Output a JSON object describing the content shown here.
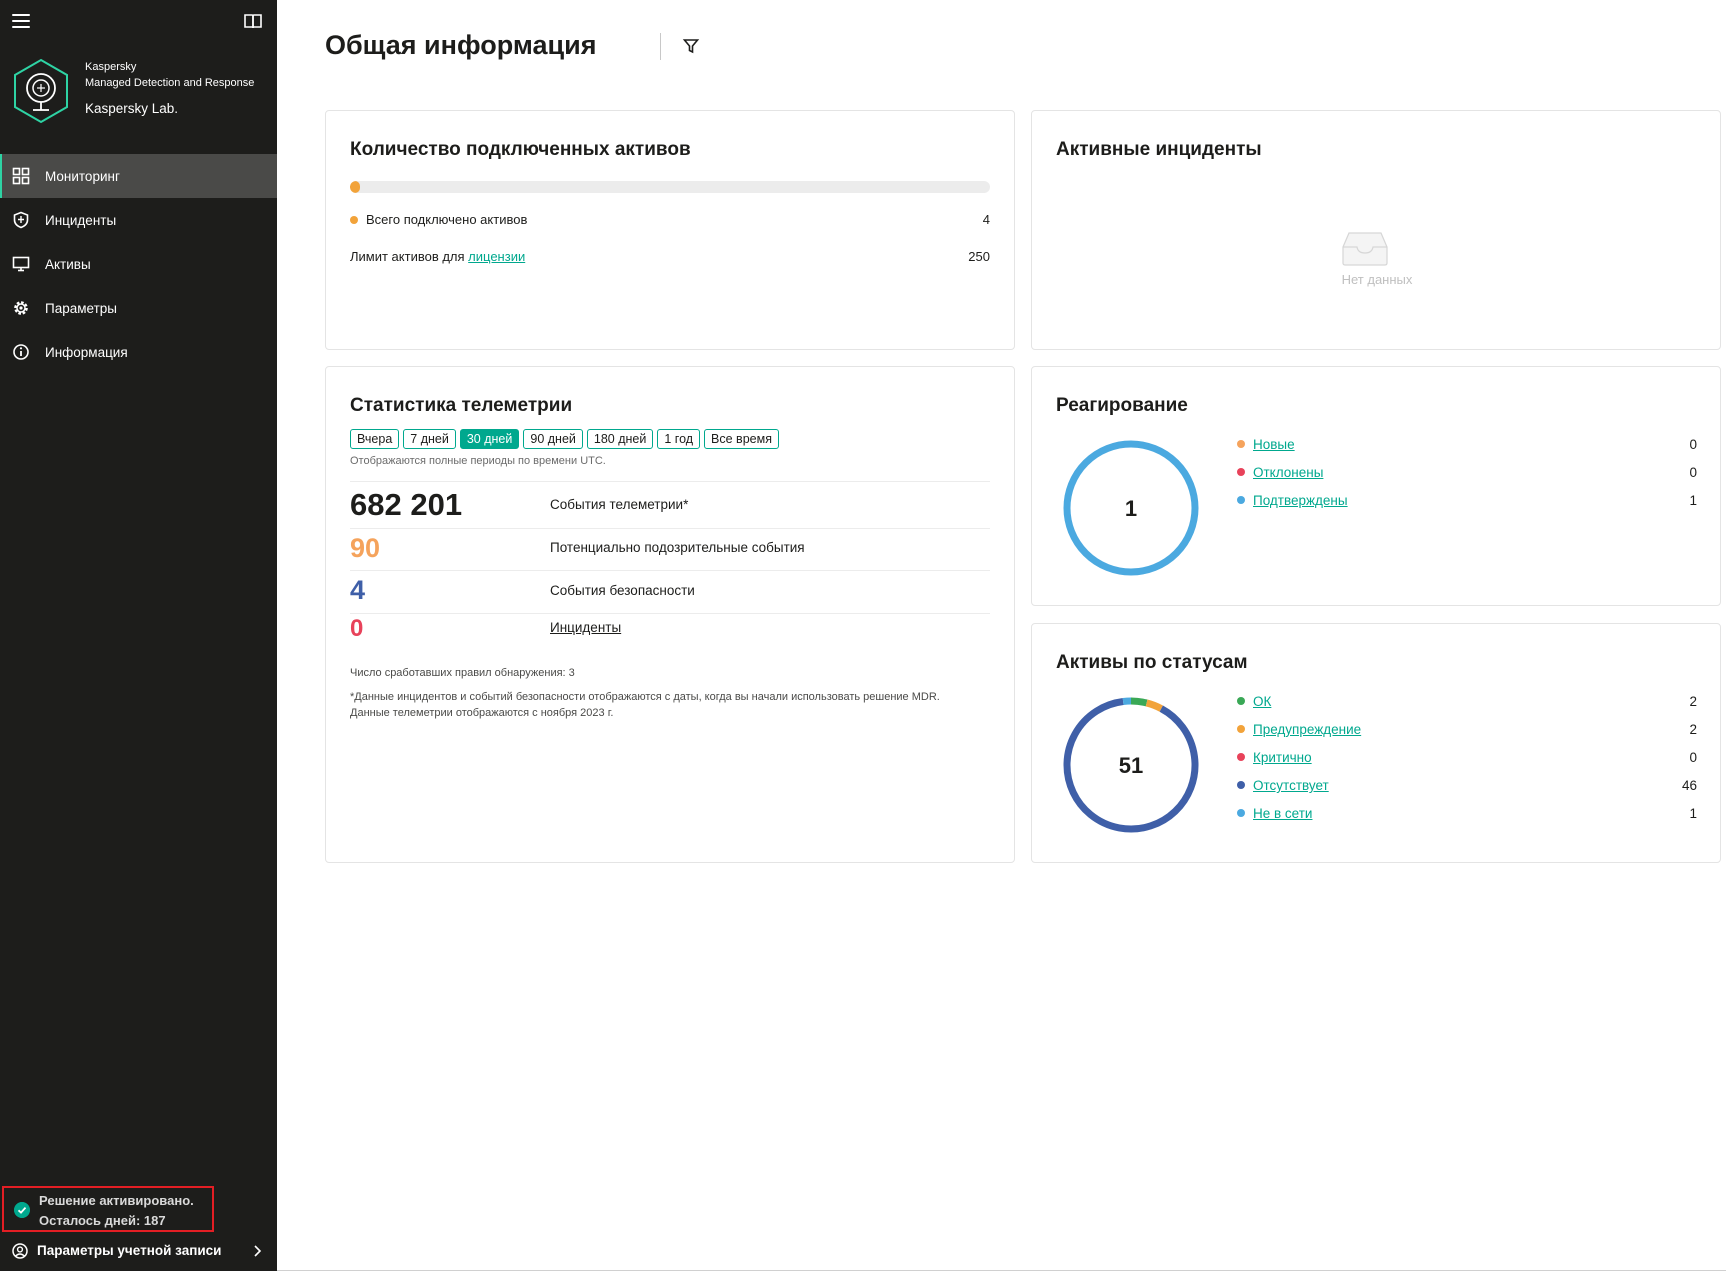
{
  "sidebar": {
    "brand": {
      "vendor": "Kaspersky",
      "product": "Managed Detection and Response",
      "organization": "Kaspersky Lab."
    },
    "nav": [
      {
        "label": "Мониторинг",
        "icon": "dashboard-icon",
        "active": true
      },
      {
        "label": "Инциденты",
        "icon": "shield-icon",
        "active": false
      },
      {
        "label": "Активы",
        "icon": "monitor-icon",
        "active": false
      },
      {
        "label": "Параметры",
        "icon": "gear-icon",
        "active": false
      },
      {
        "label": "Информация",
        "icon": "info-icon",
        "active": false
      }
    ],
    "activation": {
      "line1": "Решение активировано.",
      "line2": "Осталось дней: 187"
    },
    "account_label": "Параметры учетной записи"
  },
  "page": {
    "title": "Общая информация"
  },
  "assets_card": {
    "title": "Количество подключенных активов",
    "connected_label": "Всего подключено активов",
    "connected_value": "4",
    "limit_label_prefix": "Лимит активов для ",
    "limit_link": "лицензии",
    "limit_value": "250",
    "progress_fraction": 0.016
  },
  "incidents_card": {
    "title": "Активные инциденты",
    "empty_text": "Нет данных"
  },
  "telemetry_card": {
    "title": "Статистика телеметрии",
    "periods": [
      {
        "label": "Вчера",
        "active": false
      },
      {
        "label": "7 дней",
        "active": false
      },
      {
        "label": "30 дней",
        "active": true
      },
      {
        "label": "90 дней",
        "active": false
      },
      {
        "label": "180 дней",
        "active": false
      },
      {
        "label": "1 год",
        "active": false
      },
      {
        "label": "Все время",
        "active": false
      }
    ],
    "period_note": "Отображаются полные периоды по времени UTC.",
    "rows": [
      {
        "value": "682 201",
        "label": "События телеметрии*",
        "color": "#1d1d1b"
      },
      {
        "value": "90",
        "label": "Потенциально подозрительные события",
        "color": "#f5a35c"
      },
      {
        "value": "4",
        "label": "События безопасности",
        "color": "#3f5fa8"
      },
      {
        "value": "0",
        "label": "Инциденты",
        "color": "#e8425a"
      }
    ],
    "rules_note": "Число сработавших правил обнаружения: 3",
    "footnote1": "*Данные инцидентов и событий безопасности отображаются с даты, когда вы начали использовать решение MDR.",
    "footnote2": "Данные телеметрии отображаются с ноября 2023 г."
  },
  "response_card": {
    "title": "Реагирование",
    "total": "1",
    "items": [
      {
        "label": "Новые",
        "value": 0,
        "color": "#f5a35c"
      },
      {
        "label": "Отклонены",
        "value": 0,
        "color": "#e8425a"
      },
      {
        "label": "Подтверждены",
        "value": 1,
        "color": "#4ba9e0"
      }
    ]
  },
  "status_card": {
    "title": "Активы по статусам",
    "total": "51",
    "items": [
      {
        "label": "ОК",
        "value": 2,
        "color": "#3aa856"
      },
      {
        "label": "Предупреждение",
        "value": 2,
        "color": "#f2a33a"
      },
      {
        "label": "Критично",
        "value": 0,
        "color": "#e8425a"
      },
      {
        "label": "Отсутствует",
        "value": 46,
        "color": "#3f5fa8"
      },
      {
        "label": "Не в сети",
        "value": 1,
        "color": "#4ba9e0"
      }
    ]
  }
}
